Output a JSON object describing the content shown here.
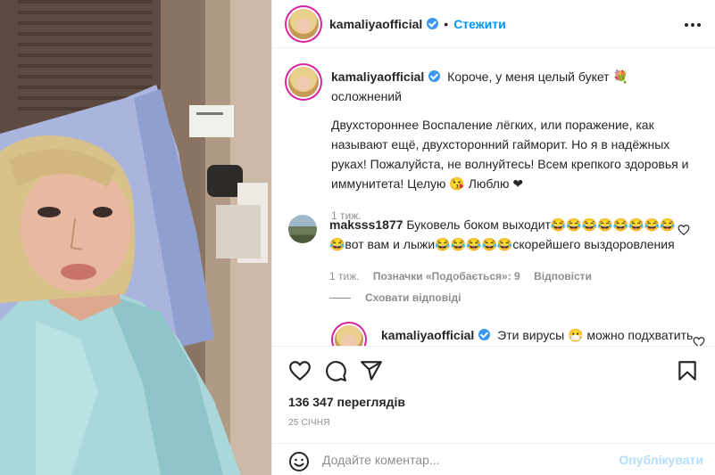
{
  "post": {
    "username": "kamaliyaofficial",
    "follow_label": "Стежити",
    "separator": "•"
  },
  "caption": {
    "username": "kamaliyaofficial",
    "line1": "Короче, у меня целый букет 💐 осложнений",
    "text": "Двухстороннее Воспаление лёгких, или поражение, как называют ещё, двухсторонний гайморит. Но я в надёжных руках! Пожалуйста, не волнуйтесь! Всем крепкого здоровья и иммунитета! Целую 😘 Люблю ❤",
    "time": "1 тиж."
  },
  "comment1": {
    "username": "maksss1877",
    "text": "Буковель боком выходит😂😂😂😂😂😂😂😂😂вот вам и лыжи😂😂😂😂😂скорейшего выздоровления",
    "time": "1 тиж.",
    "likes_label": "Позначки «Подобається»: 9",
    "reply_label": "Відповісти"
  },
  "hide_replies": "Сховати відповіді",
  "comment2": {
    "username": "kamaliyaofficial",
    "text": "Эти вирусы 😷 можно подхватить"
  },
  "stats": {
    "views": "136 347 переглядів",
    "date": "25 СІЧНЯ"
  },
  "composer": {
    "placeholder": "Додайте коментар...",
    "publish_label": "Опублікувати"
  },
  "icons": {
    "like": "heart-icon",
    "comment": "comment-icon",
    "share": "share-icon",
    "save": "bookmark-icon",
    "more": "more-icon",
    "emoji": "emoji-icon",
    "verified": "verified-badge-icon"
  },
  "colors": {
    "accent": "#0095f6",
    "publish_disabled": "#b2dffc",
    "muted": "#8e8e8e",
    "text": "#262626"
  }
}
